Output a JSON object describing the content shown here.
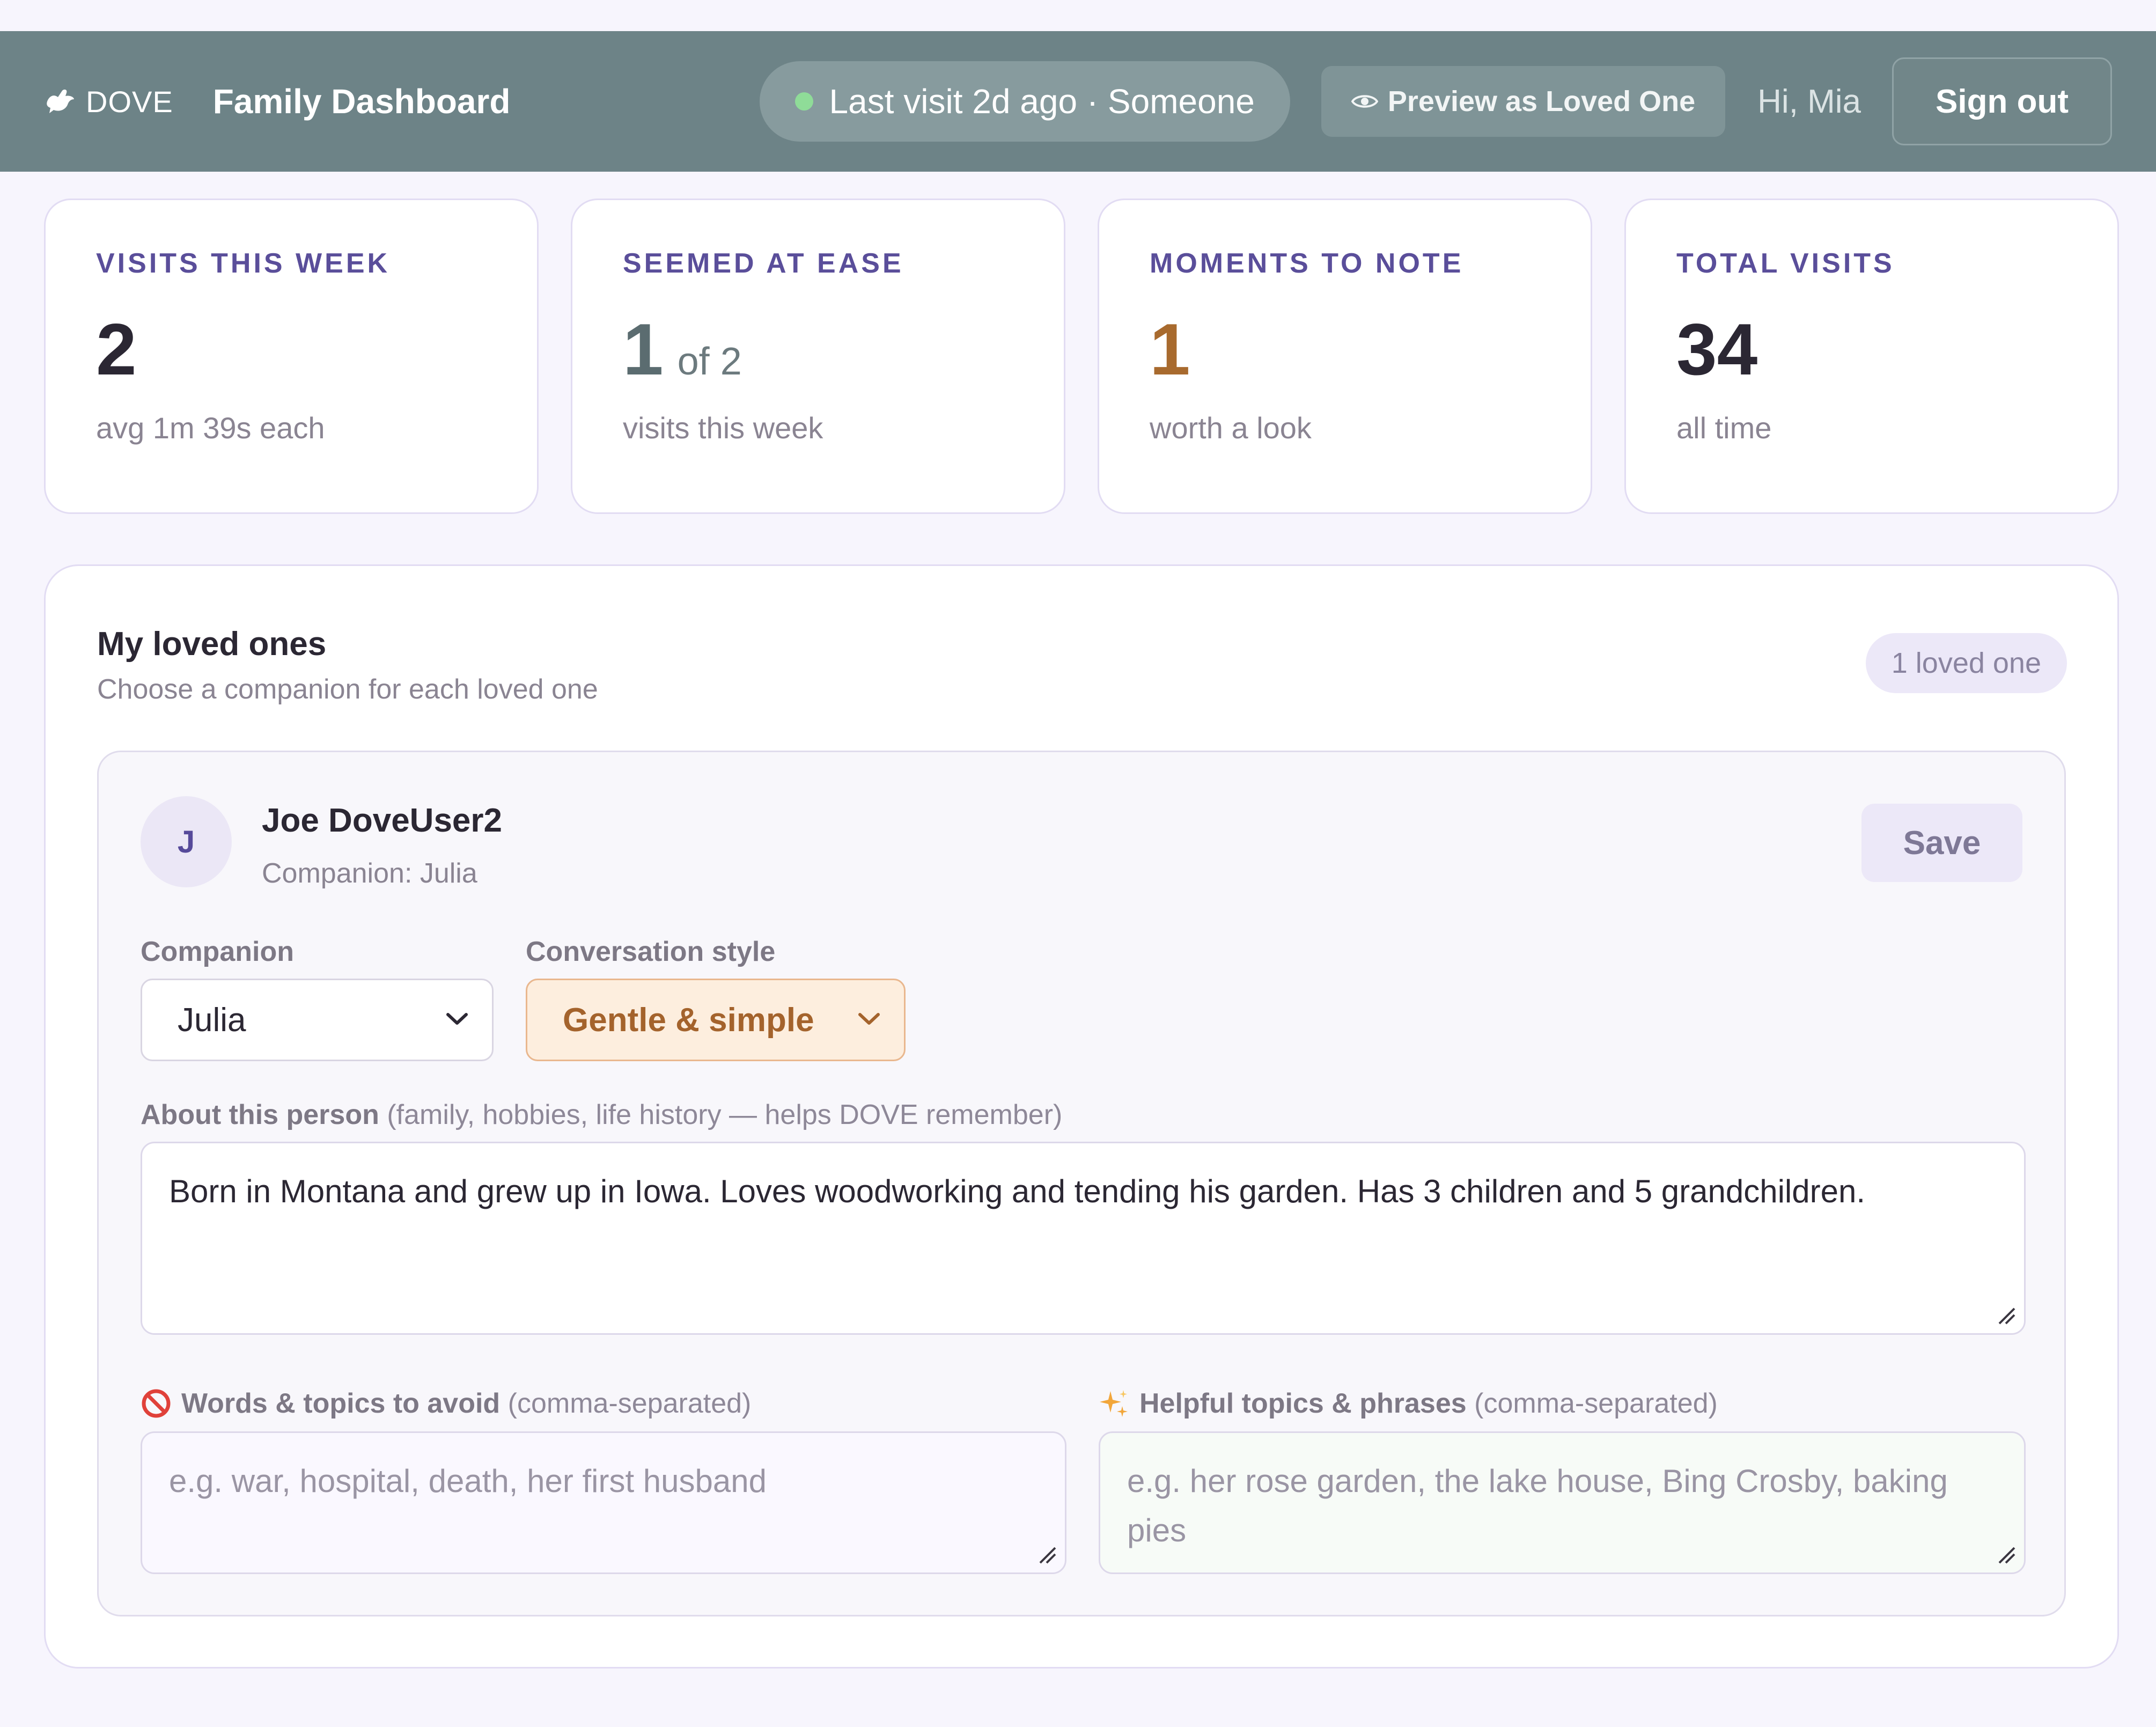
{
  "header": {
    "brand": "DOVE",
    "title": "Family Dashboard",
    "status": "Last visit 2d ago · Someone",
    "preview_label": "Preview as Loved One",
    "greeting": "Hi, Mia",
    "signout_label": "Sign out",
    "icons": {
      "brand": "dove-icon",
      "status": "status-dot",
      "preview": "eye-icon"
    },
    "colors": {
      "header_bg": "#6d8387",
      "status_dot": "#8fdc98"
    }
  },
  "stats": [
    {
      "label": "VISITS THIS WEEK",
      "value": "2",
      "of": "",
      "sub": "avg 1m 39s each"
    },
    {
      "label": "SEEMED AT EASE",
      "value": "1",
      "of": "of 2",
      "sub": "visits this week"
    },
    {
      "label": "MOMENTS TO NOTE",
      "value": "1",
      "of": "",
      "sub": "worth a look"
    },
    {
      "label": "TOTAL VISITS",
      "value": "34",
      "of": "",
      "sub": "all time"
    }
  ],
  "loved_ones": {
    "title": "My loved ones",
    "subtitle": "Choose a companion for each loved one",
    "count_badge": "1 loved one",
    "person": {
      "initial": "J",
      "name": "Joe DoveUser2",
      "companion_line": "Companion: Julia",
      "save_label": "Save",
      "companion_label": "Companion",
      "companion_value": "Julia",
      "style_label": "Conversation style",
      "style_value": "Gentle & simple",
      "about_label": "About this person",
      "about_hint": "(family, hobbies, life history — helps DOVE remember)",
      "about_value": "Born in Montana and grew up in Iowa.  Loves woodworking and tending his garden.  Has 3 children and 5 grandchildren.",
      "avoid_label": "Words & topics to avoid",
      "avoid_hint": "(comma-separated)",
      "avoid_placeholder": "e.g. war, hospital, death, her first husband",
      "helpful_label": "Helpful topics & phrases",
      "helpful_hint": "(comma-separated)",
      "helpful_placeholder": "e.g. her rose garden, the lake house, Bing Crosby, baking pies",
      "icons": {
        "avoid": "prohibited-icon",
        "helpful": "sparkles-icon"
      }
    }
  }
}
